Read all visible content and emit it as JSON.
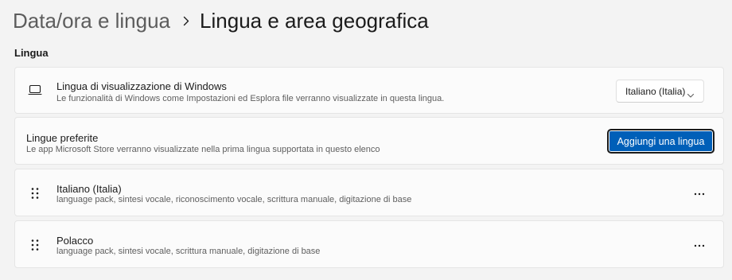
{
  "breadcrumb": {
    "parent": "Data/ora e lingua",
    "separator_icon": "chevron-right-icon",
    "current": "Lingua e area geografica"
  },
  "section": {
    "title": "Lingua"
  },
  "display_language": {
    "icon": "monitor-icon",
    "title": "Lingua di visualizzazione di Windows",
    "description": "Le funzionalità di Windows come Impostazioni ed Esplora file verranno visualizzate in questa lingua.",
    "selected": "Italiano (Italia)",
    "dropdown_icon": "chevron-down-icon"
  },
  "preferred_languages": {
    "title": "Lingue preferite",
    "description": "Le app Microsoft Store verranno visualizzate nella prima lingua supportata in questo elenco",
    "add_button": "Aggiungi una lingua"
  },
  "languages": [
    {
      "name": "Italiano (Italia)",
      "features": "language pack, sintesi vocale, riconoscimento vocale, scrittura manuale, digitazione di base",
      "more": "···"
    },
    {
      "name": "Polacco",
      "features": "language pack, sintesi vocale, scrittura manuale, digitazione di base",
      "more": "···"
    }
  ],
  "colors": {
    "accent": "#005fb8",
    "background": "#f3f3f3",
    "card": "#fbfbfb"
  }
}
